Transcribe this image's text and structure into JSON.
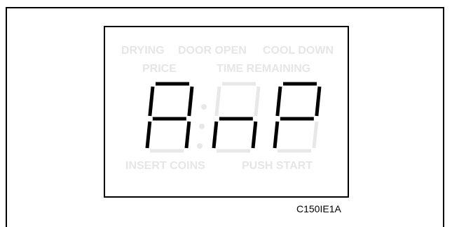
{
  "display": {
    "indicators": {
      "drying": "DRYING",
      "door_open": "DOOR OPEN",
      "cool_down": "COOL DOWN",
      "price": "PRICE",
      "time_remaining": "TIME REMAINING",
      "insert_coins": "INSERT COINS",
      "push_start": "PUSH START"
    },
    "readout": "AnP",
    "digits": [
      {
        "char": "A",
        "segments_on": [
          "a",
          "b",
          "c",
          "e",
          "f",
          "g"
        ]
      },
      {
        "char": "n",
        "segments_on": [
          "c",
          "e",
          "g"
        ]
      },
      {
        "char": "P",
        "segments_on": [
          "a",
          "b",
          "e",
          "f",
          "g"
        ]
      }
    ],
    "colon_lit": false,
    "colors": {
      "segment_on": "#000000",
      "segment_off": "#e8e8e8",
      "indicator_off": "#e6e6e6"
    }
  },
  "figure_id": "C150IE1A"
}
